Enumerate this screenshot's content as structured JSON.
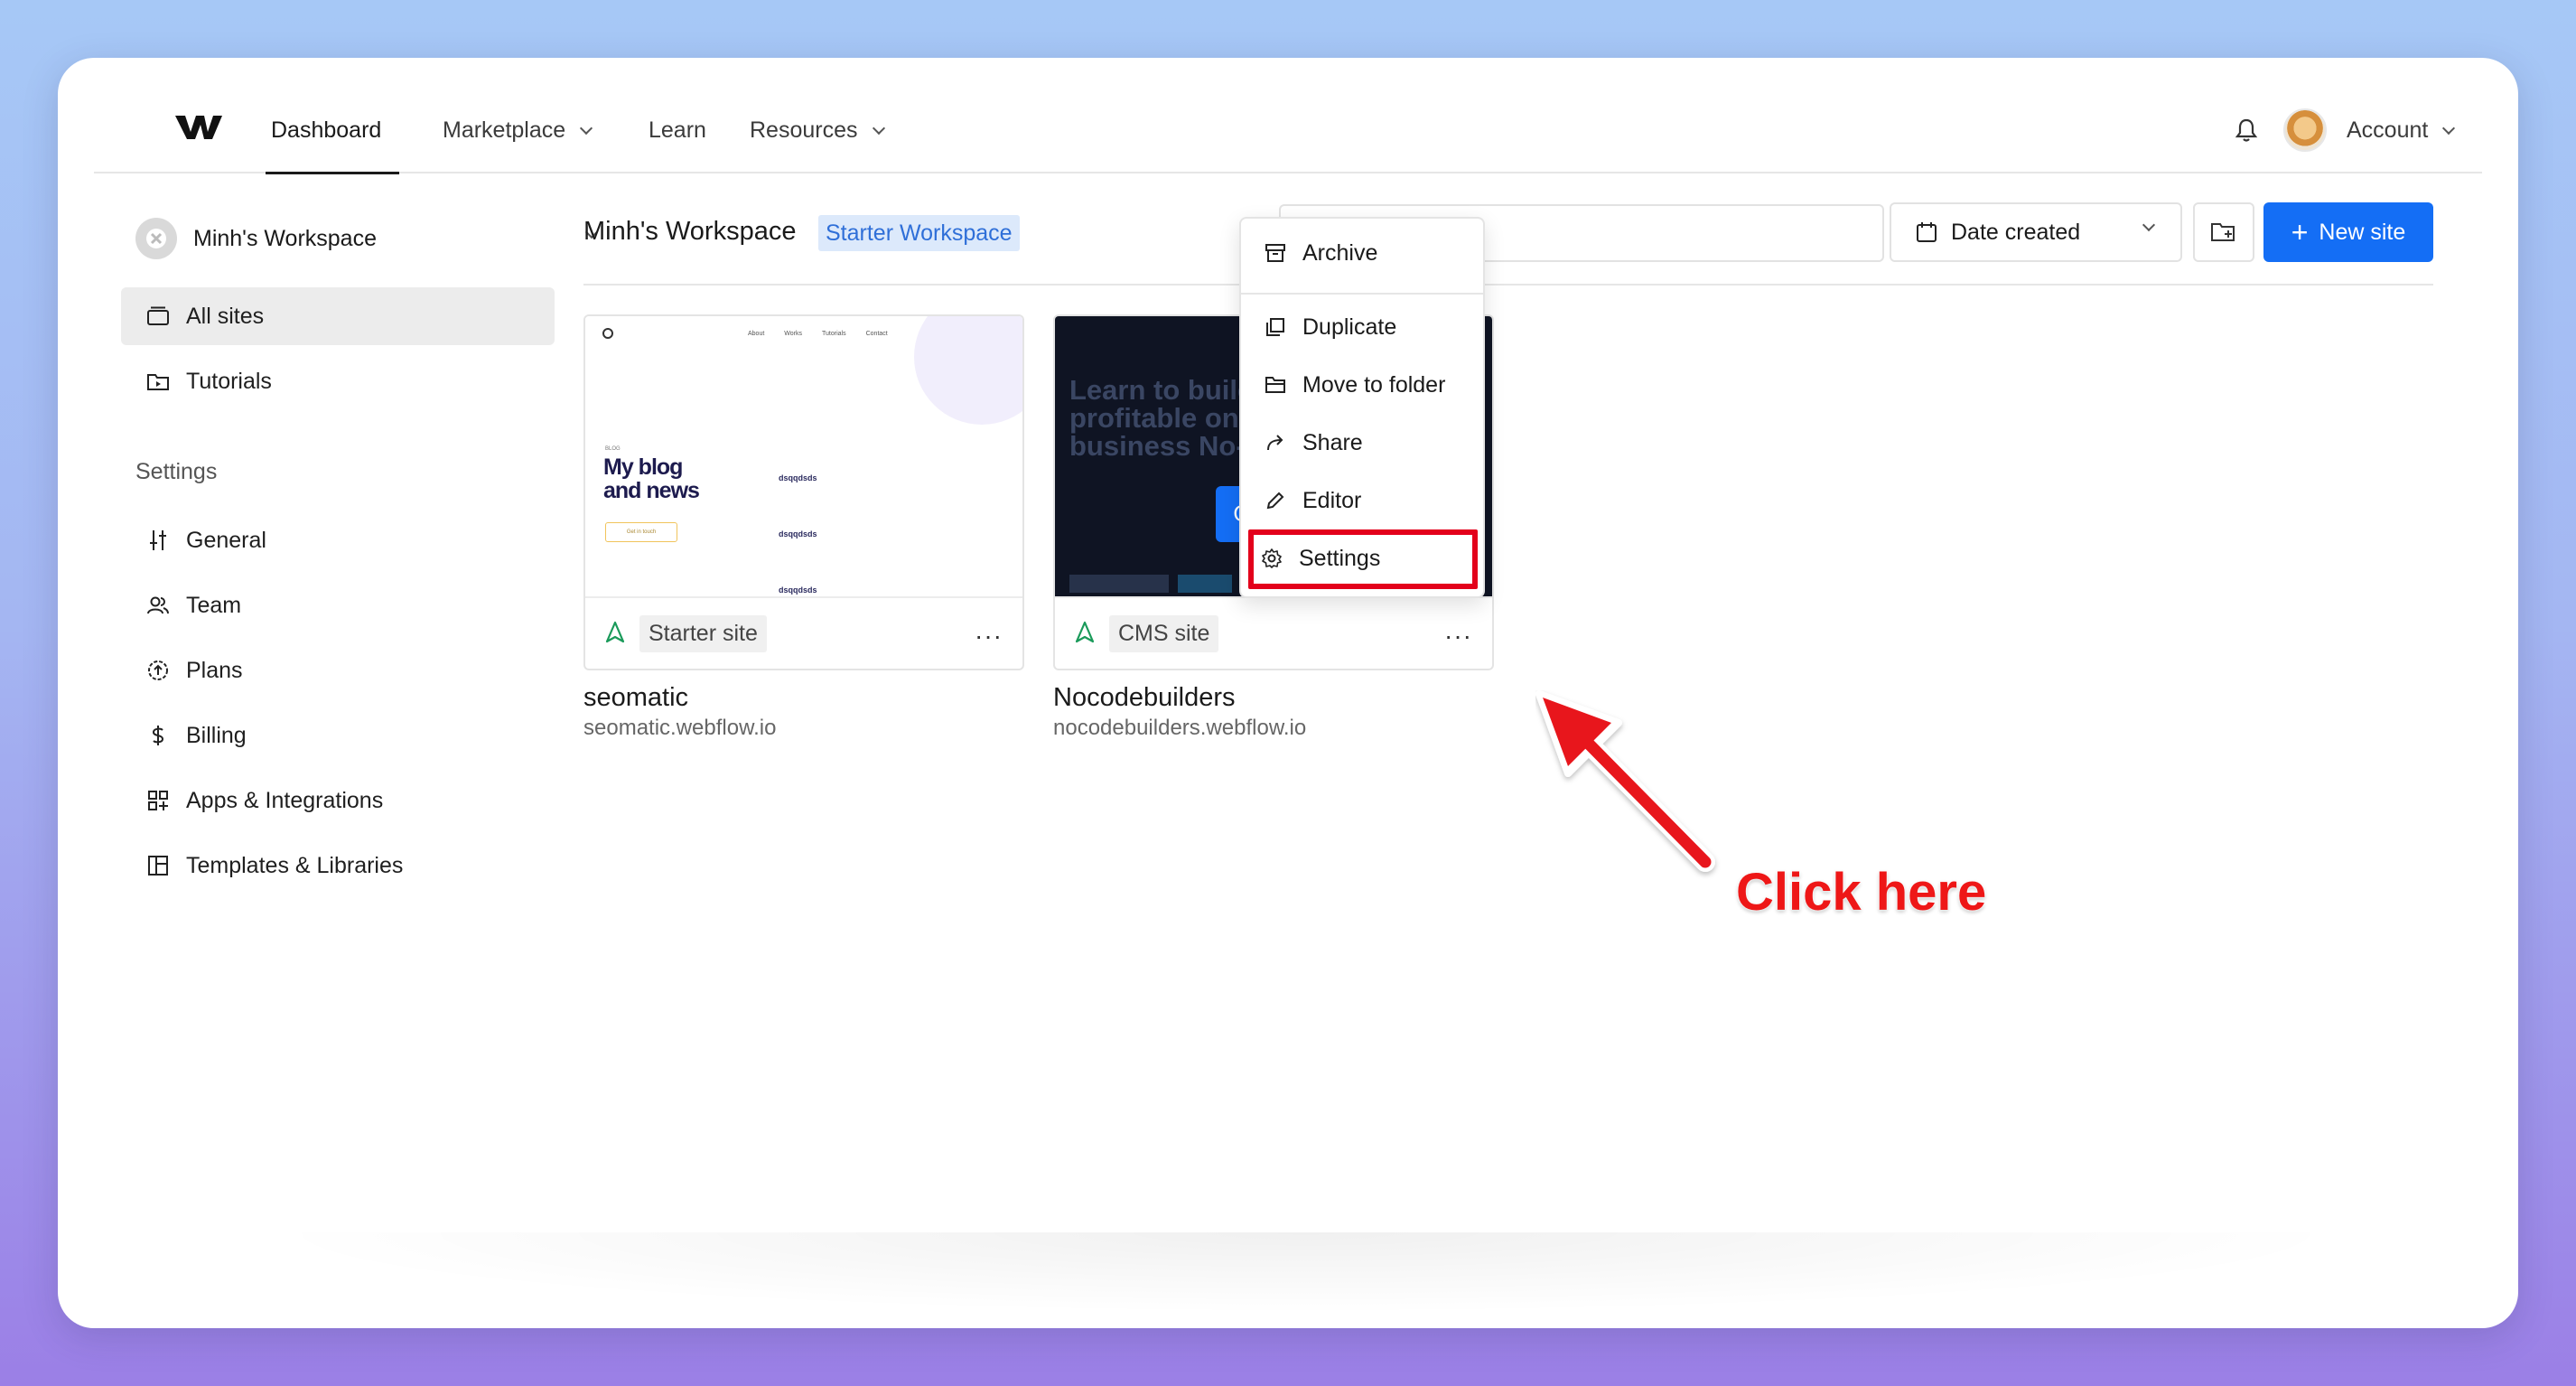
{
  "nav": {
    "items": [
      {
        "label": "Dashboard",
        "active": true
      },
      {
        "label": "Marketplace",
        "dropdown": true
      },
      {
        "label": "Learn"
      },
      {
        "label": "Resources",
        "dropdown": true
      }
    ],
    "account_label": "Account"
  },
  "sidebar": {
    "workspace_name": "Minh's Workspace",
    "items": [
      {
        "label": "All sites",
        "icon": "sites-icon",
        "active": true
      },
      {
        "label": "Tutorials",
        "icon": "tutorials-icon"
      }
    ],
    "settings_heading": "Settings",
    "settings_items": [
      {
        "label": "General",
        "icon": "sliders-icon"
      },
      {
        "label": "Team",
        "icon": "team-icon"
      },
      {
        "label": "Plans",
        "icon": "plans-icon"
      },
      {
        "label": "Billing",
        "icon": "dollar-icon"
      },
      {
        "label": "Apps & Integrations",
        "icon": "apps-icon"
      },
      {
        "label": "Templates & Libraries",
        "icon": "templates-icon"
      }
    ]
  },
  "main": {
    "title": "Minh's Workspace",
    "badge": "Starter Workspace",
    "sort_label": "Date created",
    "new_site_label": "New site"
  },
  "sites": [
    {
      "name": "seomatic",
      "url": "seomatic.webflow.io",
      "plan": "Starter site",
      "thumb": {
        "nav": [
          "About",
          "Works",
          "Tutorials",
          "Contact"
        ],
        "heading": "My blog and news",
        "kicker": "BLOG",
        "rows": [
          "dsqqdsds",
          "dsqqdsds",
          "dsqqdsds"
        ],
        "button": "Get in touch"
      }
    },
    {
      "name": "Nocodebuilders",
      "url": "nocodebuilders.webflow.io",
      "plan": "CMS site",
      "thumb": {
        "heading": "Learn to build profitable online business No-code"
      }
    }
  ],
  "open_button": "Open",
  "context_menu": {
    "items": [
      "Archive",
      "Duplicate",
      "Move to folder",
      "Share",
      "Editor",
      "Settings"
    ],
    "highlighted": "Settings"
  },
  "annotation": {
    "text": "Click here",
    "color": "#ee1717"
  },
  "colors": {
    "accent": "#146ef5",
    "badge_bg": "#dce9fb",
    "highlight": "#e3001b"
  }
}
